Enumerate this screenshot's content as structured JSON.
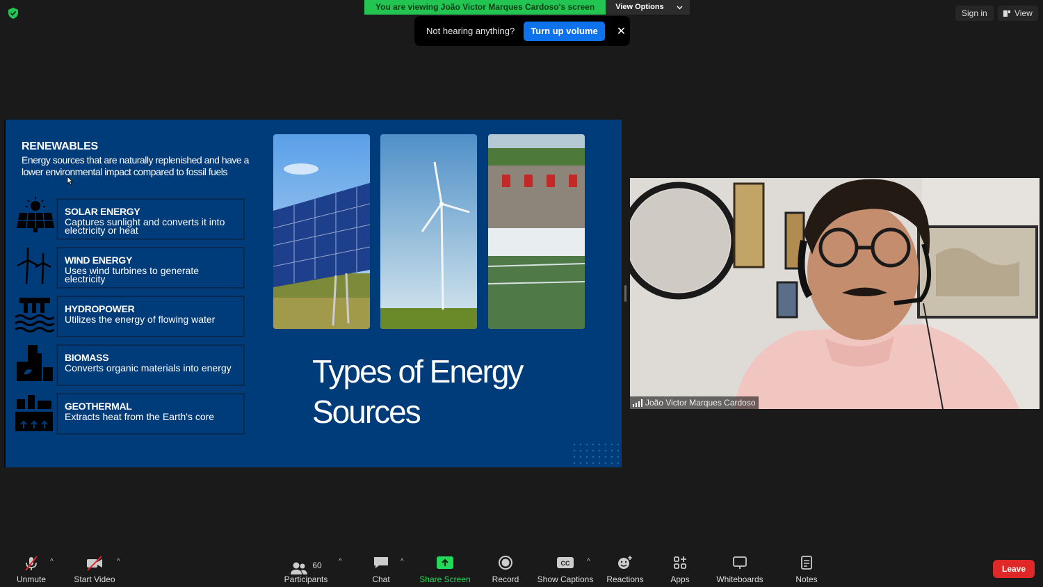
{
  "top_bar": {
    "banner": "You are viewing João Victor Marques Cardoso's screen",
    "view_options": "View Options",
    "sign_in": "Sign in",
    "view": "View"
  },
  "toast": {
    "message": "Not hearing anything?",
    "action": "Turn up volume"
  },
  "slide": {
    "heading": "RENEWABLES",
    "description": "Energy sources that are naturally replenished and have a lower environmental impact compared to fossil fuels",
    "items": [
      {
        "title": "SOLAR ENERGY",
        "desc": "Captures sunlight and converts it into electricity or heat",
        "icon": "solar-panel-icon"
      },
      {
        "title": "WIND ENERGY",
        "desc": "Uses wind turbines to generate electricity",
        "icon": "wind-turbine-icon"
      },
      {
        "title": "HYDROPOWER",
        "desc": "Utilizes the energy of flowing water",
        "icon": "dam-icon"
      },
      {
        "title": "BIOMASS",
        "desc": "Converts organic materials into energy",
        "icon": "biomass-plant-icon"
      },
      {
        "title": "GEOTHERMAL",
        "desc": "Extracts heat from the Earth's core",
        "icon": "geothermal-icon"
      }
    ],
    "title_line1": "Types of Energy",
    "title_line2": "Sources"
  },
  "video": {
    "participant_name": "João Victor Marques Cardoso"
  },
  "toolbar": {
    "unmute": "Unmute",
    "start_video": "Start Video",
    "participants": "Participants",
    "participants_count": "60",
    "chat": "Chat",
    "share_screen": "Share Screen",
    "record": "Record",
    "show_captions": "Show Captions",
    "reactions": "Reactions",
    "apps": "Apps",
    "whiteboards": "Whiteboards",
    "notes": "Notes",
    "leave": "Leave"
  },
  "colors": {
    "banner_green": "#23c552",
    "slide_blue": "#003b7a",
    "accent_blue": "#0e72ed",
    "leave_red": "#e02828",
    "share_green": "#23d959"
  }
}
